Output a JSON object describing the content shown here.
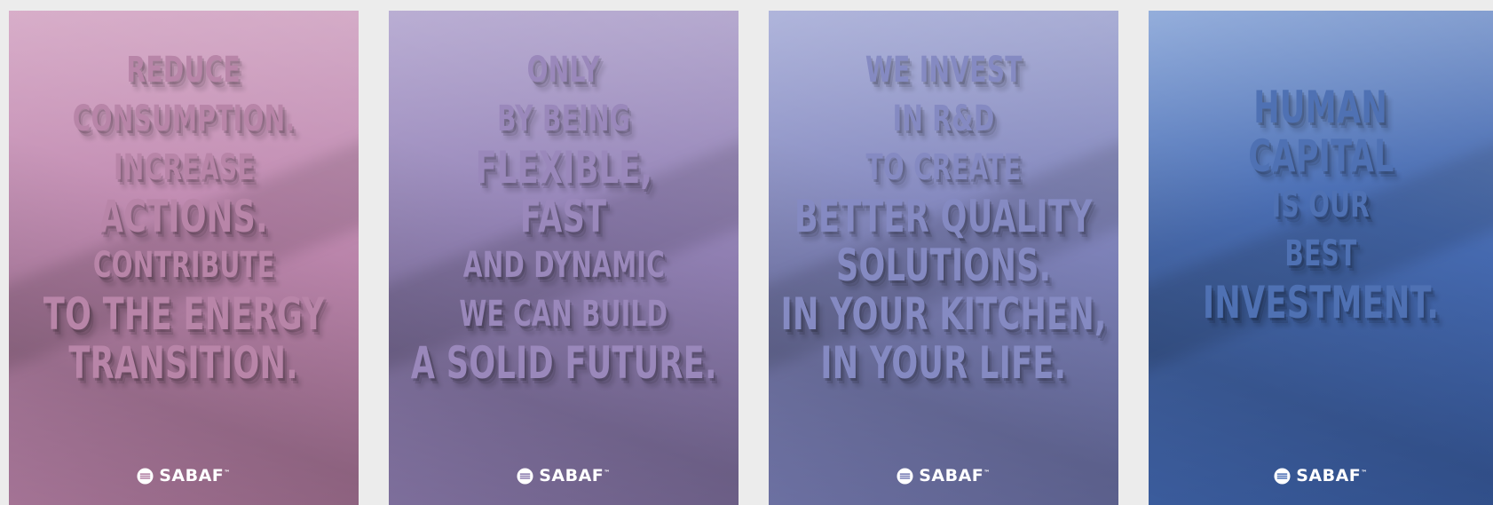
{
  "brand": {
    "name": "SABAF",
    "mark": "™",
    "logo_icon": "sabaf-logo-icon"
  },
  "posters": [
    {
      "id": "p1",
      "background": "#c08ab1",
      "lines": [
        {
          "text": "REDUCE",
          "size": "s"
        },
        {
          "text": "CONSUMPTION.",
          "size": "s"
        },
        {
          "text": "INCREASE",
          "size": "s"
        },
        {
          "text": "ACTIONS.",
          "size": "l"
        },
        {
          "text": "CONTRIBUTE",
          "size": "s"
        },
        {
          "text": "TO THE ENERGY",
          "size": "l"
        },
        {
          "text": "TRANSITION.",
          "size": "l"
        }
      ]
    },
    {
      "id": "p2",
      "background": "#9584b8",
      "lines": [
        {
          "text": "ONLY",
          "size": "s"
        },
        {
          "text": "BY BEING",
          "size": "s"
        },
        {
          "text": "FLEXIBLE,",
          "size": "l"
        },
        {
          "text": "FAST",
          "size": "l"
        },
        {
          "text": "AND DYNAMIC",
          "size": "s"
        },
        {
          "text": "WE CAN BUILD",
          "size": "s"
        },
        {
          "text": "A SOLID FUTURE.",
          "size": "l"
        }
      ]
    },
    {
      "id": "p3",
      "background": "#8286bd",
      "lines": [
        {
          "text": "WE INVEST",
          "size": "s"
        },
        {
          "text": "IN R&D",
          "size": "s"
        },
        {
          "text": "TO CREATE",
          "size": "s"
        },
        {
          "text": "BETTER QUALITY",
          "size": "l"
        },
        {
          "text": "SOLUTIONS.",
          "size": "l"
        },
        {
          "text": "IN YOUR KITCHEN,",
          "size": "l"
        },
        {
          "text": "IN YOUR LIFE.",
          "size": "l"
        }
      ]
    },
    {
      "id": "p4",
      "background": "#4a6eb4",
      "lines": [
        {
          "text": "HUMAN",
          "size": "l"
        },
        {
          "text": "CAPITAL",
          "size": "l"
        },
        {
          "text": "IS OUR",
          "size": "s"
        },
        {
          "text": "BEST",
          "size": "s"
        },
        {
          "text": "INVESTMENT.",
          "size": "l"
        }
      ]
    }
  ]
}
